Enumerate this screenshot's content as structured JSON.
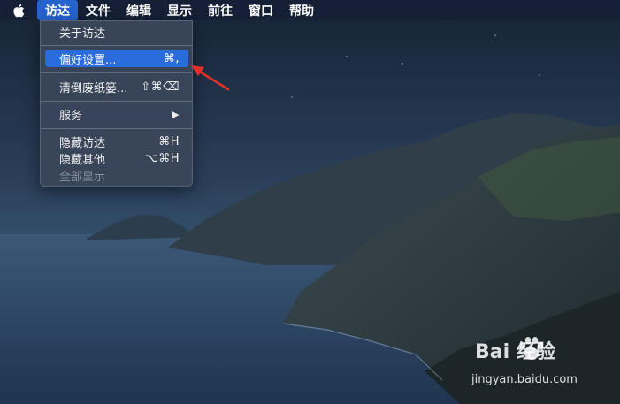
{
  "menubar": {
    "apple_icon": "apple-logo",
    "items": [
      {
        "label": "访达",
        "active": true
      },
      {
        "label": "文件"
      },
      {
        "label": "编辑"
      },
      {
        "label": "显示"
      },
      {
        "label": "前往"
      },
      {
        "label": "窗口"
      },
      {
        "label": "帮助"
      }
    ]
  },
  "dropdown": {
    "about": {
      "label": "关于访达"
    },
    "preferences": {
      "label": "偏好设置...",
      "shortcut": "⌘,"
    },
    "empty_trash": {
      "label": "清倒废纸篓...",
      "shortcut": "⇧⌘⌫"
    },
    "services": {
      "label": "服务",
      "shortcut": "▶"
    },
    "hide_finder": {
      "label": "隐藏访达",
      "shortcut": "⌘H"
    },
    "hide_others": {
      "label": "隐藏其他",
      "shortcut": "⌥⌘H"
    },
    "show_all": {
      "label": "全部显示"
    }
  },
  "colors": {
    "highlight": "#2a6cdc",
    "arrow": "#e0322a"
  },
  "watermark": {
    "brand": "Bai   经验",
    "url": "jingyan.baidu.com"
  }
}
